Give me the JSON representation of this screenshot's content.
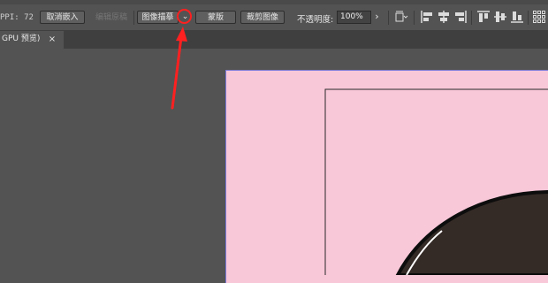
{
  "control_bar": {
    "ppi_text": "PPI: 72",
    "unembed_label": "取消嵌入",
    "edit_original_label": "编辑原稿",
    "image_trace_label": "图像描摹",
    "image_trace_menu_icon": "chevron-down-icon",
    "mask_label": "蒙版",
    "crop_image_label": "裁剪图像",
    "opacity_label": "不透明度:",
    "opacity_value": "100%",
    "opacity_arrow_icon": "chevron-right-icon",
    "icons": [
      "transform-options-icon",
      "align-left-icon",
      "align-horizontal-center-icon",
      "align-right-icon",
      "align-top-icon",
      "align-vertical-center-icon",
      "align-bottom-icon",
      "grid-icon"
    ]
  },
  "document_tab": {
    "label": "GPU 预览)",
    "close_icon": "close-icon",
    "close_symbol": "×"
  },
  "annotation": {
    "color": "#ff2020",
    "target": "image-trace-dropdown-button"
  },
  "colors": {
    "ui_background": "#535353",
    "tab_bar": "#3f3f3f",
    "artboard_fill": "#f8c7d8",
    "artboard_border": "#7a7ad6",
    "illustration_dark": "#342a26"
  }
}
